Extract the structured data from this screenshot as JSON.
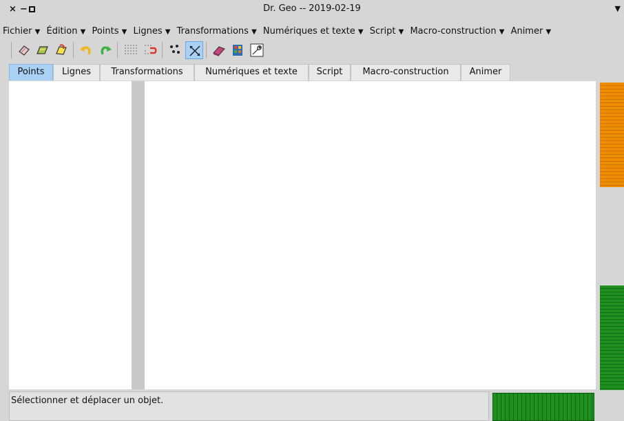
{
  "window": {
    "title": "Dr. Geo -- 2019-02-19",
    "close_glyph": "×",
    "minimize_glyph": "−",
    "menu_glyph": "▼"
  },
  "menubar": {
    "items": [
      {
        "label": "Fichier"
      },
      {
        "label": "Édition"
      },
      {
        "label": "Points"
      },
      {
        "label": "Lignes"
      },
      {
        "label": "Transformations"
      },
      {
        "label": "Numériques et texte"
      },
      {
        "label": "Script"
      },
      {
        "label": "Macro-construction"
      },
      {
        "label": "Animer"
      }
    ],
    "arrow": "▼"
  },
  "toolbar": {
    "buttons": [
      {
        "icon": "new-sketch-icon"
      },
      {
        "icon": "open-icon"
      },
      {
        "icon": "save-icon"
      },
      {
        "icon": "undo-icon"
      },
      {
        "icon": "redo-icon"
      },
      {
        "icon": "grid-icon"
      },
      {
        "icon": "magnet-grid-icon"
      },
      {
        "icon": "select-points-icon"
      },
      {
        "icon": "select-move-icon",
        "selected": true
      },
      {
        "icon": "eraser-icon"
      },
      {
        "icon": "style-icon"
      },
      {
        "icon": "properties-icon"
      }
    ]
  },
  "tabs": [
    {
      "label": "Points",
      "active": true
    },
    {
      "label": "Lignes"
    },
    {
      "label": "Transformations"
    },
    {
      "label": "Numériques et texte"
    },
    {
      "label": "Script"
    },
    {
      "label": "Macro-construction"
    },
    {
      "label": "Animer"
    }
  ],
  "status": {
    "message": "Sélectionner et déplacer un objet."
  },
  "colors": {
    "accent": "#a9d0f5",
    "scroll_orange": "#ef8c00",
    "scroll_green": "#1f8f1f"
  }
}
